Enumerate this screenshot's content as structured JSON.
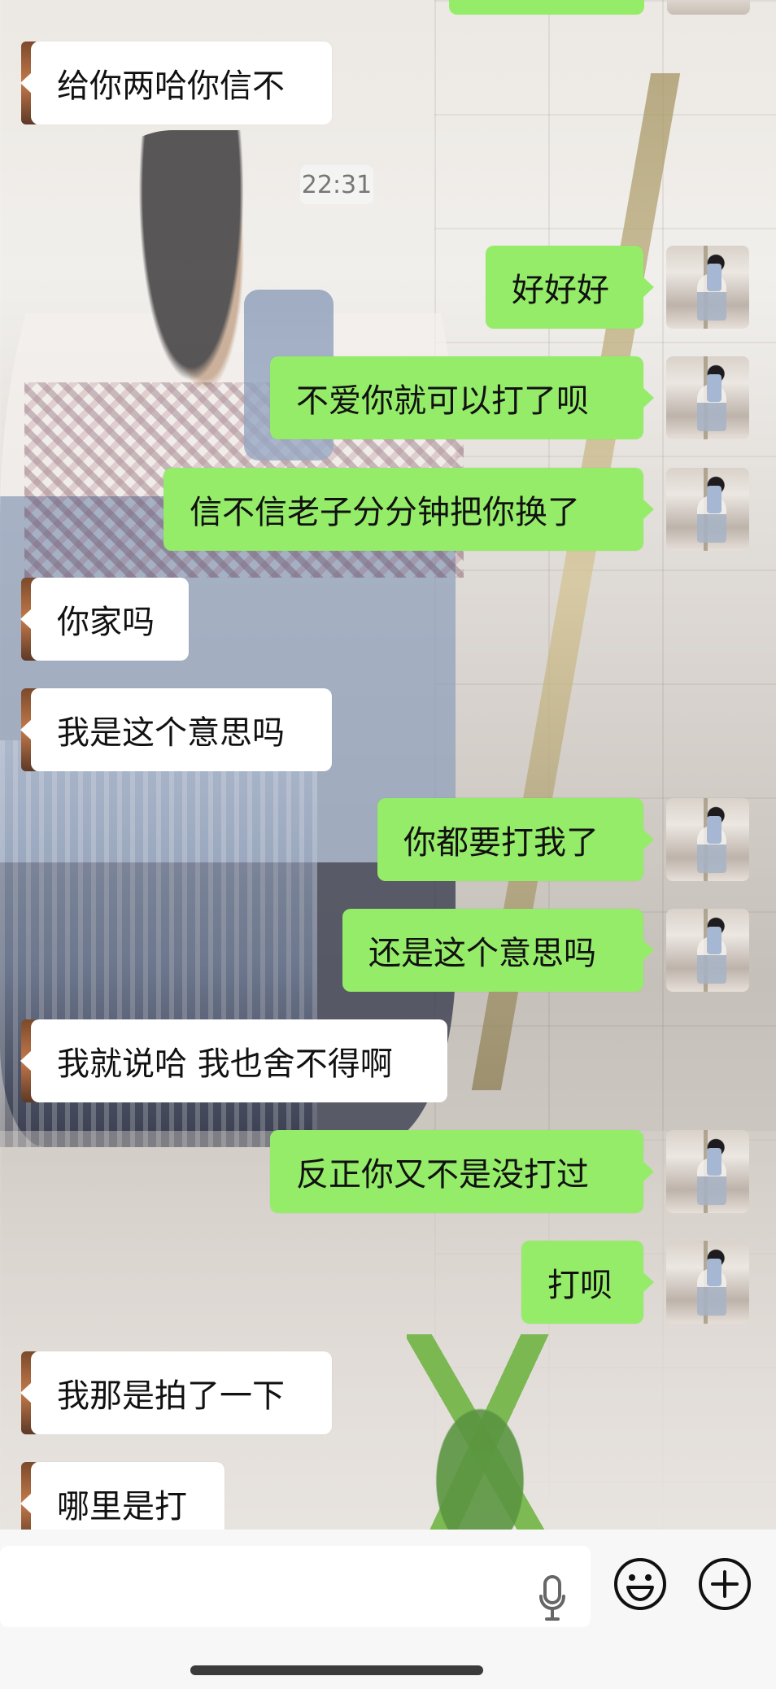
{
  "chat": {
    "timestamp": "22:31",
    "messages": [
      {
        "side": "left",
        "text": "给你两哈你信不"
      },
      {
        "side": "right",
        "text": "好好好"
      },
      {
        "side": "right",
        "text": "不爱你就可以打了呗"
      },
      {
        "side": "right",
        "text": "信不信老子分分钟把你换了"
      },
      {
        "side": "left",
        "text": "你家吗"
      },
      {
        "side": "left",
        "text": "我是这个意思吗"
      },
      {
        "side": "right",
        "text": "你都要打我了"
      },
      {
        "side": "right",
        "text": "还是这个意思吗"
      },
      {
        "side": "left",
        "text": "我就说哈 我也舍不得啊"
      },
      {
        "side": "right",
        "text": "反正你又不是没打过"
      },
      {
        "side": "right",
        "text": "打呗"
      },
      {
        "side": "left",
        "text": "我那是拍了一下"
      },
      {
        "side": "left",
        "text": "哪里是打"
      }
    ]
  },
  "input": {
    "value": "",
    "icons": [
      "microphone-icon",
      "emoji-icon",
      "plus-icon"
    ]
  },
  "colors": {
    "incoming_bubble": "#ffffff",
    "outgoing_bubble": "#95ec69",
    "input_bar": "#f7f7f7"
  }
}
